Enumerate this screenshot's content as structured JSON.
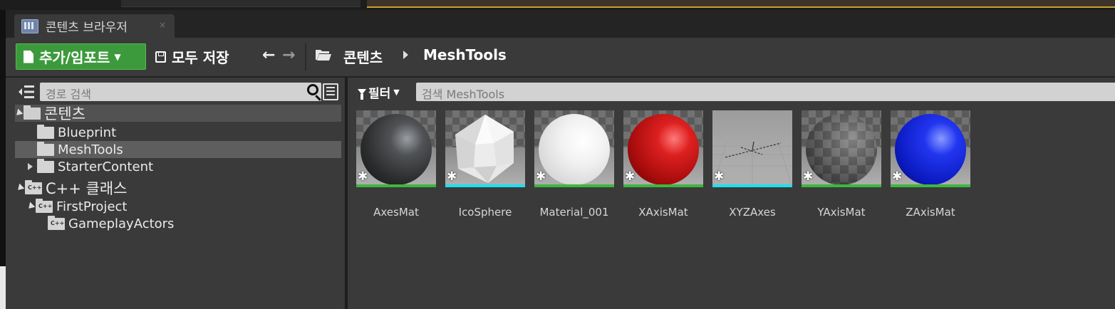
{
  "tab": {
    "title": "콘텐츠 브라우저",
    "close": "×"
  },
  "toolbar": {
    "add_label": "추가/임포트",
    "save_label": "모두 저장",
    "back": "🡐",
    "forward": "🡒"
  },
  "breadcrumb": {
    "root": "콘텐츠",
    "current": "MeshTools"
  },
  "sources": {
    "search_placeholder": "경로 검색",
    "tree": [
      {
        "label": "콘텐츠"
      },
      {
        "label": "Blueprint"
      },
      {
        "label": "MeshTools"
      },
      {
        "label": "StarterContent"
      },
      {
        "label": "C++ 클래스"
      },
      {
        "label": "FirstProject"
      },
      {
        "label": "GameplayActors"
      }
    ]
  },
  "assets": {
    "filter_label": "필터",
    "search_placeholder": "검색 MeshTools",
    "items": [
      {
        "name": "AxesMat",
        "kind": "material",
        "color": "#3e3f40"
      },
      {
        "name": "IcoSphere",
        "kind": "static-mesh",
        "color": "#e8e8e8"
      },
      {
        "name": "Material_001",
        "kind": "material",
        "color": "#f0f0f0"
      },
      {
        "name": "XAxisMat",
        "kind": "material",
        "color": "#c81818"
      },
      {
        "name": "XYZAxes",
        "kind": "static-mesh",
        "color": "#9a9a9a"
      },
      {
        "name": "YAxisMat",
        "kind": "material",
        "color": "#5a5a5a"
      },
      {
        "name": "ZAxisMat",
        "kind": "material",
        "color": "#1a2ad8"
      }
    ]
  },
  "colors": {
    "add_button": "#3c9a3c",
    "material_bar": "#3cb83c",
    "mesh_bar": "#1ee0f0"
  }
}
